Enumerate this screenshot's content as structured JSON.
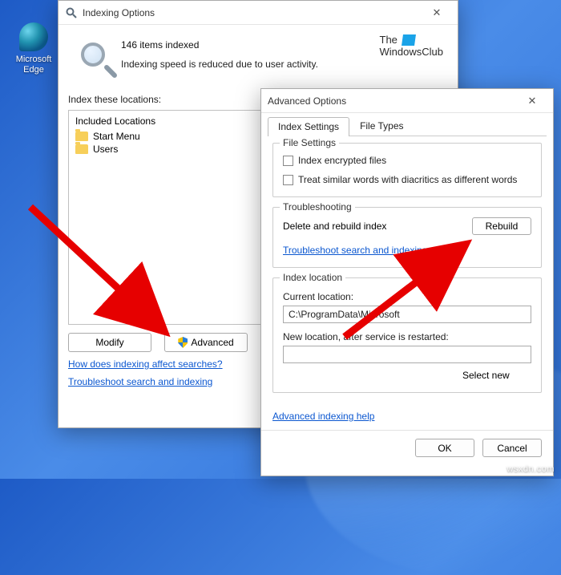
{
  "desktop": {
    "edge_label": "Microsoft\nEdge"
  },
  "indexing": {
    "title": "Indexing Options",
    "items_indexed": "146 items indexed",
    "status": "Indexing speed is reduced due to user activity.",
    "brand_line1": "The",
    "brand_line2": "WindowsClub",
    "section_label": "Index these locations:",
    "included_header": "Included Locations",
    "locations": [
      "Start Menu",
      "Users"
    ],
    "modify_btn": "Modify",
    "advanced_btn": "Advanced",
    "link_how": "How does indexing affect searches?",
    "link_troubleshoot": "Troubleshoot search and indexing"
  },
  "advanced": {
    "title": "Advanced Options",
    "tab_settings": "Index Settings",
    "tab_filetypes": "File Types",
    "file_settings_legend": "File Settings",
    "chk_encrypted": "Index encrypted files",
    "chk_diacritics": "Treat similar words with diacritics as different words",
    "troubleshooting_legend": "Troubleshooting",
    "delete_rebuild_label": "Delete and rebuild index",
    "rebuild_btn": "Rebuild",
    "troubleshoot_link": "Troubleshoot search and indexing",
    "index_location_legend": "Index location",
    "current_location_label": "Current location:",
    "current_location_value": "C:\\ProgramData\\Microsoft",
    "new_location_label": "New location, after service is restarted:",
    "new_location_value": "",
    "select_new_btn": "Select new",
    "adv_help_link": "Advanced indexing help",
    "ok_btn": "OK",
    "cancel_btn": "Cancel"
  },
  "watermark": "wsxdn.com"
}
